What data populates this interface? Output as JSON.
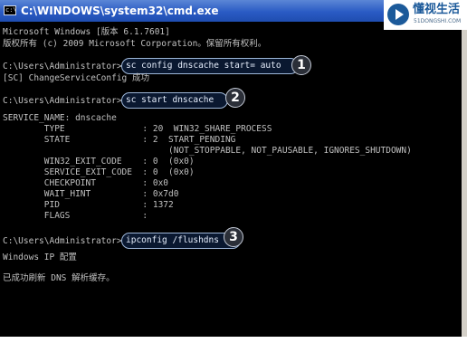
{
  "window": {
    "title": "C:\\WINDOWS\\system32\\cmd.exe",
    "icon_name": "cmd-icon",
    "icon_text": "c:\\"
  },
  "watermark": {
    "icon_name": "play-logo-icon",
    "text": "懂视生活",
    "subtext": "51DONGSHI.COM"
  },
  "console": {
    "lines": [
      "Microsoft Windows [版本 6.1.7601]",
      "版权所有 (c) 2009 Microsoft Corporation。保留所有权利。",
      "C:\\Users\\Administrator>",
      "[SC] ChangeServiceConfig 成功",
      "C:\\Users\\Administrator>",
      "SERVICE_NAME: dnscache",
      "        TYPE               : 20  WIN32_SHARE_PROCESS",
      "        STATE              : 2  START_PENDING",
      "                                (NOT_STOPPABLE, NOT_PAUSABLE, IGNORES_SHUTDOWN)",
      "        WIN32_EXIT_CODE    : 0  (0x0)",
      "        SERVICE_EXIT_CODE  : 0  (0x0)",
      "        CHECKPOINT         : 0x0",
      "        WAIT_HINT          : 0x7d0",
      "        PID                : 1372",
      "        FLAGS              :",
      "C:\\Users\\Administrator>",
      "Windows IP 配置",
      "已成功刷新 DNS 解析缓存。"
    ],
    "commands": [
      {
        "text": "sc config dnscache start= auto",
        "step": "1"
      },
      {
        "text": "sc start dnscache",
        "step": "2"
      },
      {
        "text": "ipconfig /flushdns",
        "step": "3"
      }
    ]
  }
}
